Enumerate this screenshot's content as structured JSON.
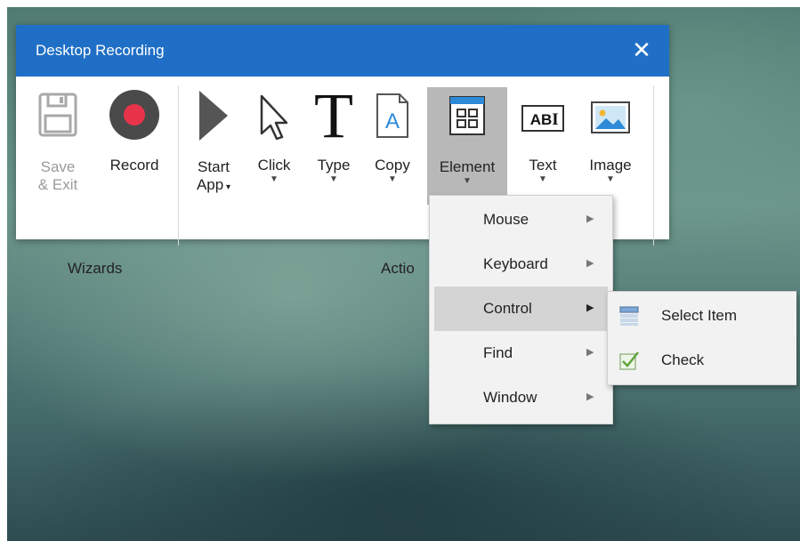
{
  "window": {
    "title": "Desktop Recording",
    "close_glyph": "✕"
  },
  "ribbon": {
    "wizards": {
      "label": "Wizards",
      "save_exit": {
        "line1": "Save",
        "line2": "& Exit",
        "icon": "floppy-disk-icon"
      },
      "record": {
        "label": "Record",
        "icon": "record-icon",
        "color": "#e8344a"
      }
    },
    "actions": {
      "label_visible": "Actio",
      "start_app": {
        "line1": "Start",
        "line2": "App",
        "icon": "play-icon"
      },
      "click": {
        "label": "Click",
        "icon": "cursor-arrow-icon"
      },
      "type": {
        "label": "Type",
        "icon": "letter-t-icon"
      },
      "copy": {
        "label": "Copy",
        "icon": "copy-document-icon"
      },
      "element": {
        "label": "Element",
        "icon": "element-grid-icon",
        "active": true
      },
      "text": {
        "label": "Text",
        "icon": "text-abi-icon"
      },
      "image": {
        "label": "Image",
        "icon": "picture-icon"
      }
    }
  },
  "element_menu": {
    "items": [
      {
        "label": "Mouse"
      },
      {
        "label": "Keyboard"
      },
      {
        "label": "Control",
        "selected": true
      },
      {
        "label": "Find"
      },
      {
        "label": "Window"
      }
    ]
  },
  "control_submenu": {
    "items": [
      {
        "label": "Select Item",
        "icon": "select-item-icon"
      },
      {
        "label": "Check",
        "icon": "checkbox-icon"
      }
    ]
  },
  "colors": {
    "titlebar": "#1f6fc6",
    "active_button": "#b8b8b8",
    "record_red": "#e8344a"
  }
}
